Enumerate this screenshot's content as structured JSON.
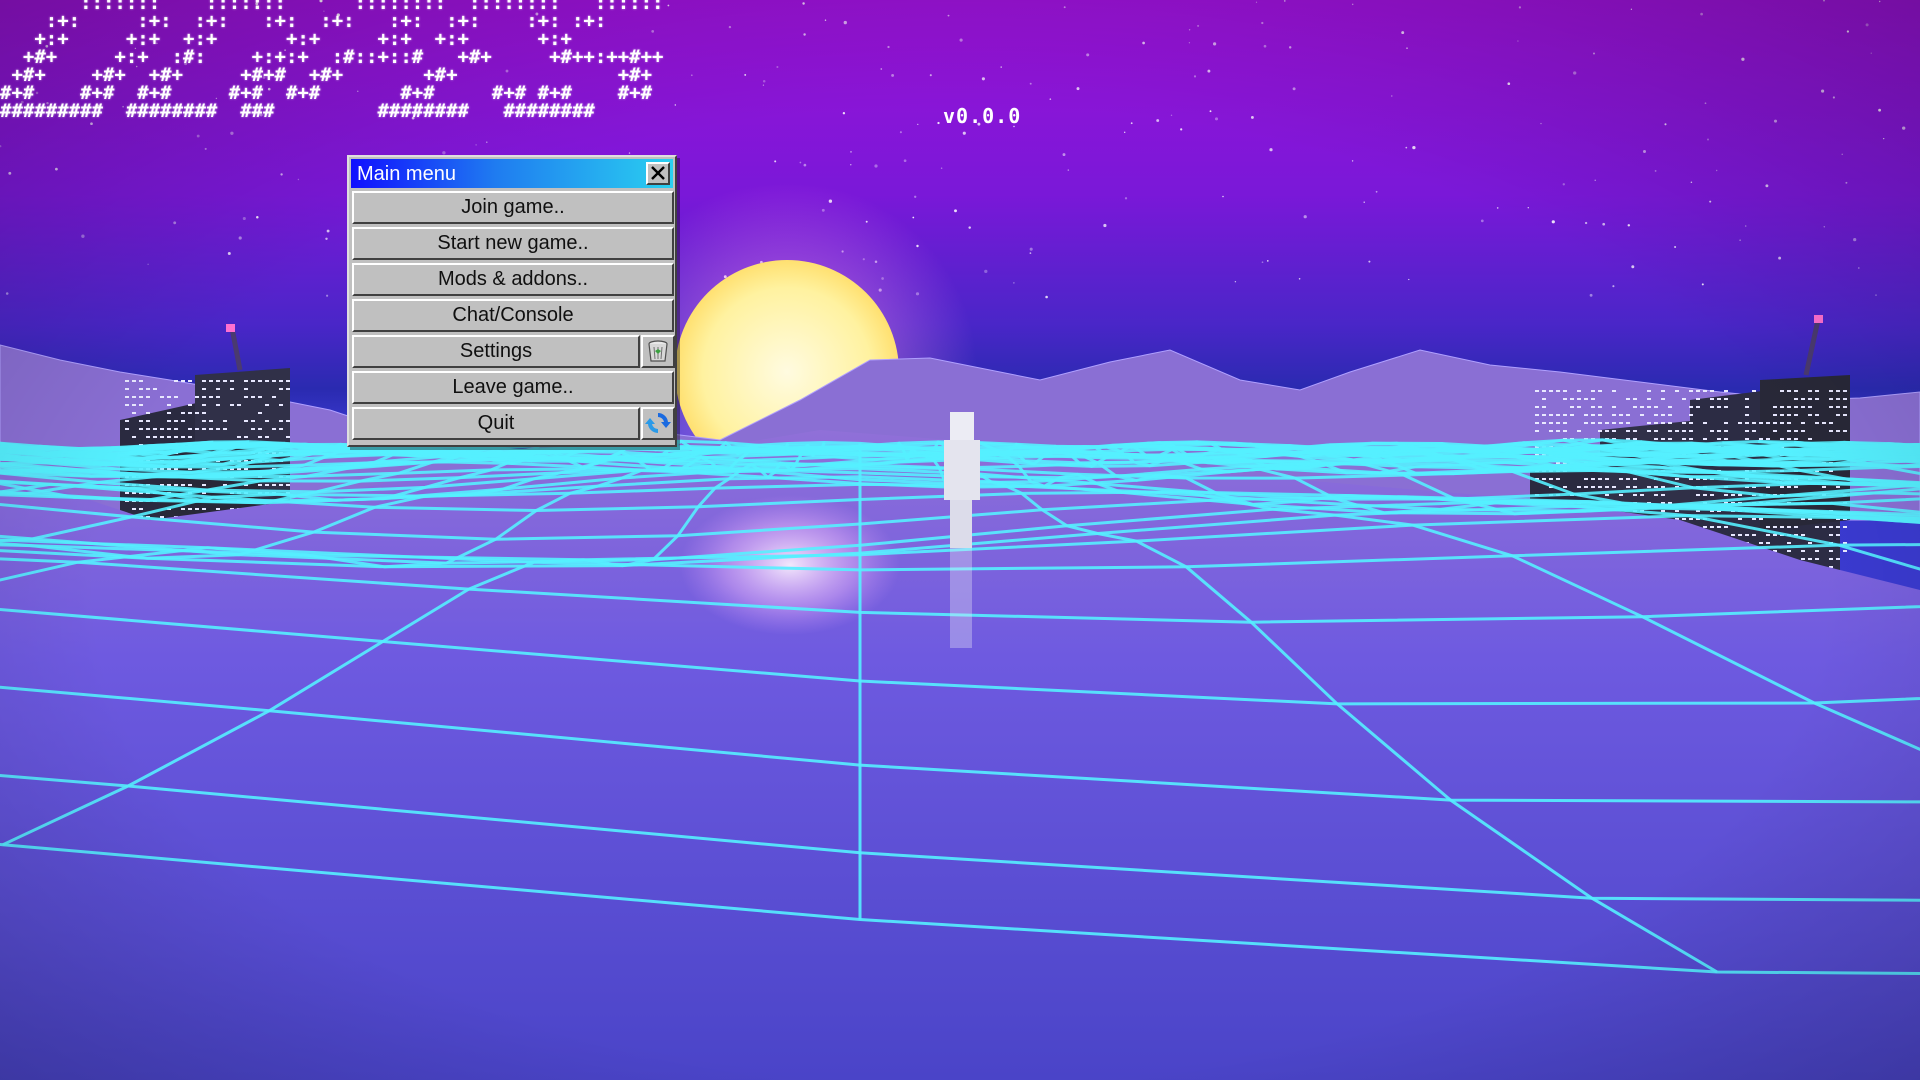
{
  "logo": {
    "ascii_lines": [
      "       :::::::    :::::::      ::::::::  ::::::::   ::::::",
      "    :+:     :+:  :+:   :+:  :+:   :+:  :+:    :+: :+:",
      "   +:+     +:+  +:+      +:+     +:+  +:+      +:+",
      "  +#+     +:+  :#:    +:+:+  :#::+::#   +#+     +#++:++#++",
      " +#+    +#+  +#+     +#+#  +#+       +#+              +#+",
      "#+#    #+#  #+#     #+#  #+#       #+#     #+# #+#    #+#",
      "#########  ########  ###         ########   ########"
    ],
    "version": "v0.0.0"
  },
  "main_menu": {
    "title": "Main menu",
    "close_icon": "close-x-icon",
    "buttons": [
      {
        "label": "Join game.."
      },
      {
        "label": "Start new game.."
      },
      {
        "label": "Mods & addons.."
      },
      {
        "label": "Chat/Console"
      },
      {
        "label": "Settings",
        "side_icon": "recycle-bin-icon"
      },
      {
        "label": "Leave game.."
      },
      {
        "label": "Quit",
        "side_icon": "refresh-arrows-icon"
      }
    ]
  },
  "scene": {
    "style": "synthwave wireframe terrain",
    "colors": {
      "sky_top": "#9a12d6",
      "sky_horizon": "#2a2aa8",
      "grid_line": "#55f0ff",
      "sun": "#fff8c0",
      "terrain_fill": "#5f4fd8"
    }
  }
}
